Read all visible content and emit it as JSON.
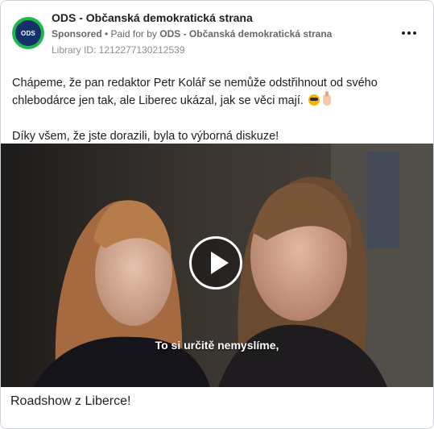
{
  "post": {
    "page_name": "ODS - Občanská demokratická strana",
    "avatar_text": "ODS",
    "sponsored_label": "Sponsored",
    "paid_for_prefix": " • Paid for by ",
    "paid_for_name": "ODS - Občanská demokratická strana",
    "library_id": "Library ID: 1212277130212539",
    "body_paragraph_1": "Chápeme, že pan redaktor Petr Kolář se nemůže odstřihnout od svého chlebodárce jen tak, ale Liberec ukázal, jak se věci mají.",
    "body_paragraph_2": "Díky všem, že jste dorazili, byla to výborná diskuze!",
    "video_subtitle": "To si určitě nemyslíme,",
    "link_title": "Roadshow z Liberce!"
  },
  "colors": {
    "avatar_ring": "#1fb84a",
    "avatar_fill": "#13306b",
    "text_primary": "#1c1e21",
    "text_secondary": "#65676b"
  },
  "icons": [
    "more-options-icon",
    "play-icon",
    "sunglasses-emoji-icon",
    "hand-emoji-icon"
  ]
}
